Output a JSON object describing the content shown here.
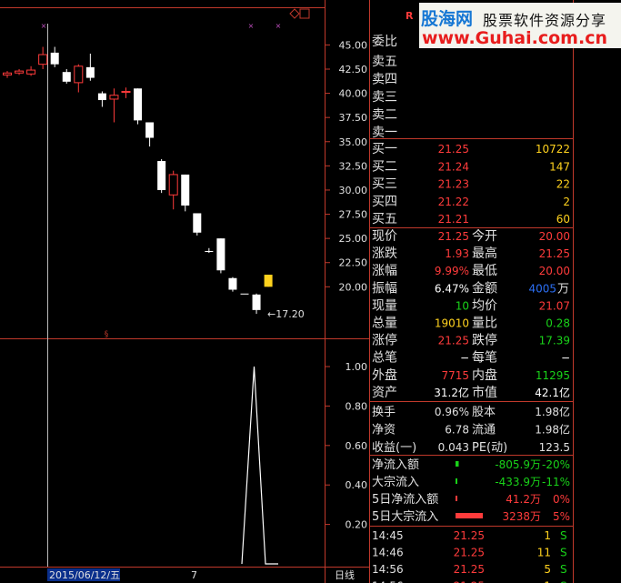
{
  "colors": {
    "up": "#ff3b3b",
    "down": "#54ffff",
    "neutral": "#ffffff",
    "label": "#e0e0e0",
    "axis": "#c8a000",
    "frame": "#c0392b",
    "green": "#19d219",
    "yellow": "#ffd21e",
    "blue": "#2c6ff5"
  },
  "top_right_marker": "R",
  "header_icons": [
    "diamond-icon",
    "restore-icon"
  ],
  "watermark": {
    "brand": "股海网",
    "tagline": "股票软件资源分享",
    "url": "www.Guhai.com.cn"
  },
  "chart_data": [
    {
      "type": "candlestick",
      "ylim": [
        15.8,
        47.2
      ],
      "yticks": [
        45.0,
        42.5,
        40.0,
        37.5,
        35.0,
        32.5,
        30.0,
        27.5,
        25.0,
        22.5,
        20.0
      ],
      "ytick_labels": [
        "45.00",
        "42.50",
        "40.00",
        "37.50",
        "35.00",
        "32.50",
        "30.00",
        "27.50",
        "25.00",
        "22.50",
        "20.00"
      ],
      "candles": [
        {
          "o": 41.9,
          "h": 42.3,
          "l": 41.6,
          "c": 42.1
        },
        {
          "o": 42.1,
          "h": 42.5,
          "l": 41.9,
          "c": 42.3
        },
        {
          "o": 42.0,
          "h": 42.8,
          "l": 41.8,
          "c": 42.4
        },
        {
          "o": 43.0,
          "h": 44.8,
          "l": 42.5,
          "c": 44.0
        },
        {
          "o": 44.2,
          "h": 44.8,
          "l": 42.7,
          "c": 43.0
        },
        {
          "o": 42.2,
          "h": 42.5,
          "l": 41.0,
          "c": 41.2
        },
        {
          "o": 41.1,
          "h": 43.0,
          "l": 40.1,
          "c": 42.8
        },
        {
          "o": 42.7,
          "h": 44.1,
          "l": 41.3,
          "c": 41.6
        },
        {
          "o": 40.0,
          "h": 40.2,
          "l": 38.6,
          "c": 39.3
        },
        {
          "o": 39.4,
          "h": 40.5,
          "l": 37.0,
          "c": 39.8
        },
        {
          "o": 40.1,
          "h": 40.6,
          "l": 39.5,
          "c": 40.2
        },
        {
          "o": 40.5,
          "h": 40.5,
          "l": 36.8,
          "c": 37.2
        },
        {
          "o": 37.0,
          "h": 37.0,
          "l": 34.5,
          "c": 35.4
        },
        {
          "o": 33.0,
          "h": 33.2,
          "l": 29.7,
          "c": 30.0
        },
        {
          "o": 29.5,
          "h": 32.0,
          "l": 28.0,
          "c": 31.6
        },
        {
          "o": 31.6,
          "h": 31.6,
          "l": 27.8,
          "c": 28.4
        },
        {
          "o": 27.6,
          "h": 27.6,
          "l": 25.3,
          "c": 25.6
        },
        {
          "o": 23.7,
          "h": 24.0,
          "l": 23.5,
          "c": 23.6
        },
        {
          "o": 25.0,
          "h": 25.0,
          "l": 21.4,
          "c": 21.7
        },
        {
          "o": 20.9,
          "h": 21.0,
          "l": 19.5,
          "c": 19.7
        },
        {
          "o": 19.3,
          "h": 19.3,
          "l": 19.3,
          "c": 19.3
        },
        {
          "o": 19.2,
          "h": 19.3,
          "l": 17.2,
          "c": 17.6
        },
        {
          "o": 20.0,
          "h": 21.25,
          "l": 20.0,
          "c": 21.25
        }
      ],
      "annotation": "←17.20",
      "x_axis_labels": [
        "2015/06/12/五",
        "7"
      ],
      "period_label": "日线"
    },
    {
      "type": "line",
      "ylim": [
        0,
        1.12
      ],
      "yticks": [
        1.0,
        0.8,
        0.6,
        0.4,
        0.2
      ],
      "ytick_labels": [
        "1.00",
        "0.80",
        "0.60",
        "0.40",
        "0.20"
      ],
      "values": [
        0,
        1,
        0,
        0
      ]
    }
  ],
  "order_book": {
    "header": {
      "label": "委比",
      "value": "",
      "vol": ""
    },
    "asks": [
      {
        "label": "卖五",
        "price": "",
        "vol": ""
      },
      {
        "label": "卖四",
        "price": "",
        "vol": ""
      },
      {
        "label": "卖三",
        "price": "",
        "vol": ""
      },
      {
        "label": "卖二",
        "price": "",
        "vol": ""
      },
      {
        "label": "卖一",
        "price": "",
        "vol": ""
      }
    ],
    "bids": [
      {
        "label": "买一",
        "price": "21.25",
        "vol": "10722"
      },
      {
        "label": "买二",
        "price": "21.24",
        "vol": "147"
      },
      {
        "label": "买三",
        "price": "21.23",
        "vol": "22"
      },
      {
        "label": "买四",
        "price": "21.22",
        "vol": "2"
      },
      {
        "label": "买五",
        "price": "21.21",
        "vol": "60"
      }
    ]
  },
  "quote_stats": [
    {
      "l1": "现价",
      "v1": "21.25",
      "c1": "up",
      "l2": "今开",
      "v2": "20.00",
      "c2": "up"
    },
    {
      "l1": "涨跌",
      "v1": "1.93",
      "c1": "up",
      "l2": "最高",
      "v2": "21.25",
      "c2": "up"
    },
    {
      "l1": "涨幅",
      "v1": "9.99%",
      "c1": "up",
      "l2": "最低",
      "v2": "20.00",
      "c2": "up"
    },
    {
      "l1": "振幅",
      "v1": "6.47%",
      "c1": "neutral",
      "l2": "金额",
      "v2": "4005",
      "v2u": "万",
      "c2": "blue"
    },
    {
      "l1": "现量",
      "v1": "10",
      "c1": "green",
      "l2": "均价",
      "v2": "21.07",
      "c2": "up"
    },
    {
      "l1": "总量",
      "v1": "19010",
      "c1": "yellow",
      "l2": "量比",
      "v2": "0.28",
      "c2": "green"
    },
    {
      "l1": "涨停",
      "v1": "21.25",
      "c1": "up",
      "l2": "跌停",
      "v2": "17.39",
      "c2": "green"
    },
    {
      "l1": "总笔",
      "v1": "−",
      "c1": "neutral",
      "l2": "每笔",
      "v2": "−",
      "c2": "neutral"
    },
    {
      "l1": "外盘",
      "v1": "7715",
      "c1": "up",
      "l2": "内盘",
      "v2": "11295",
      "c2": "green"
    },
    {
      "l1": "资产",
      "v1": "31.2亿",
      "c1": "neutral",
      "l2": "市值",
      "v2": "42.1亿",
      "c2": "neutral"
    }
  ],
  "finance_stats": [
    {
      "l1": "换手",
      "v1": "0.96%",
      "l2": "股本",
      "v2": "1.98亿"
    },
    {
      "l1": "净资",
      "v1": "6.78",
      "l2": "流通",
      "v2": "1.98亿"
    },
    {
      "l1": "收益(一)",
      "v1": "0.043",
      "l2": "PE(动)",
      "v2": "123.5"
    }
  ],
  "fund_flows": [
    {
      "label": "净流入额",
      "amount": "-805.9万",
      "pct": "-20%",
      "color": "green",
      "bar": 0.07
    },
    {
      "label": "大宗流入",
      "amount": "-433.9万",
      "pct": "-11%",
      "color": "green",
      "bar": 0.02
    },
    {
      "label": "5日净流入额",
      "amount": "41.2万",
      "pct": "0%",
      "color": "up",
      "bar": 0.01
    },
    {
      "label": "5日大宗流入",
      "amount": "3238万",
      "pct": "5%",
      "color": "up",
      "bar": 0.6
    }
  ],
  "ticks": [
    {
      "time": "14:45",
      "price": "21.25",
      "vol": "1",
      "side": "S"
    },
    {
      "time": "14:46",
      "price": "21.25",
      "vol": "11",
      "side": "S"
    },
    {
      "time": "14:56",
      "price": "21.25",
      "vol": "5",
      "side": "S"
    },
    {
      "time": "14:56",
      "price": "21.25",
      "vol": "1",
      "side": "S"
    }
  ]
}
